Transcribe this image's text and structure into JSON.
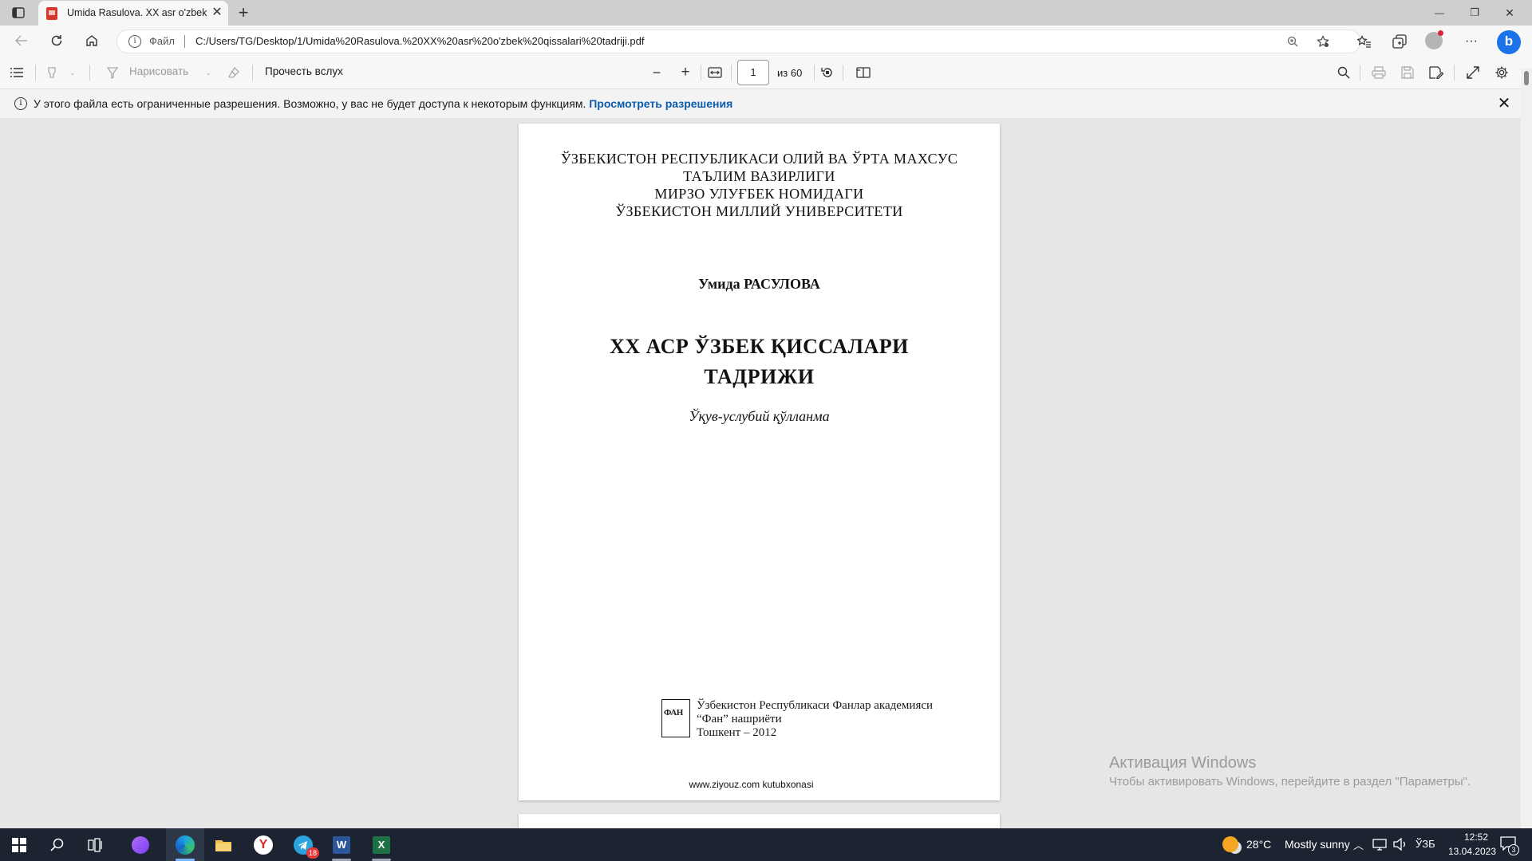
{
  "browser": {
    "tab_title": "Umida Rasulova. XX asr o'zbek qissalari tadriji.pdf",
    "tab_close": "✕",
    "new_tab": "+",
    "address": {
      "protocol": "Файл",
      "url": "C:/Users/TG/Desktop/1/Umida%20Rasulova.%20XX%20asr%20o'zbek%20qissalari%20tadriji.pdf"
    },
    "window_controls": {
      "minimize": "—",
      "restore": "❐",
      "close": "✕"
    }
  },
  "pdf_toolbar": {
    "draw_label": "Нарисовать",
    "read_aloud": "Прочесть вслух",
    "zoom_out": "−",
    "zoom_in": "+",
    "page_current": "1",
    "page_of": "из 60"
  },
  "infobar": {
    "message": "У этого файла есть ограниченные разрешения. Возможно, у вас не будет доступа к некоторым функциям.",
    "link": "Просмотреть разрешения"
  },
  "page1": {
    "header_lines": [
      "ЎЗБЕКИСТОН РЕСПУБЛИКАСИ ОЛИЙ ВА ЎРТА МАХСУС",
      "ТАЪЛИМ ВАЗИРЛИГИ",
      "МИРЗО УЛУҒБЕК НОМИДАГИ",
      "ЎЗБЕКИСТОН МИЛЛИЙ УНИВЕРСИТЕТИ"
    ],
    "author": "Умида РАСУЛОВА",
    "title_lines": [
      "XX АСР ЎЗБЕК ҚИССАЛАРИ",
      "ТАДРИЖИ"
    ],
    "subtitle": "Ўқув-услубий қўлланма",
    "publisher_logo": "ФАН",
    "publisher_lines": [
      "Ўзбекистон Республикаси Фанлар академияси",
      "“Фан” нашриёти",
      "Тошкент – 2012"
    ],
    "footer": "www.ziyouz.com kutubxonasi"
  },
  "watermark": {
    "line1": "Активация Windows",
    "line2": "Чтобы активировать Windows, перейдите в раздел \"Параметры\"."
  },
  "taskbar": {
    "telegram_badge": "18",
    "weather_temp": "28°C",
    "weather_text": "Mostly sunny",
    "language": "ЎЗБ",
    "time": "12:52",
    "date": "13.04.2023",
    "notifications": "3"
  }
}
